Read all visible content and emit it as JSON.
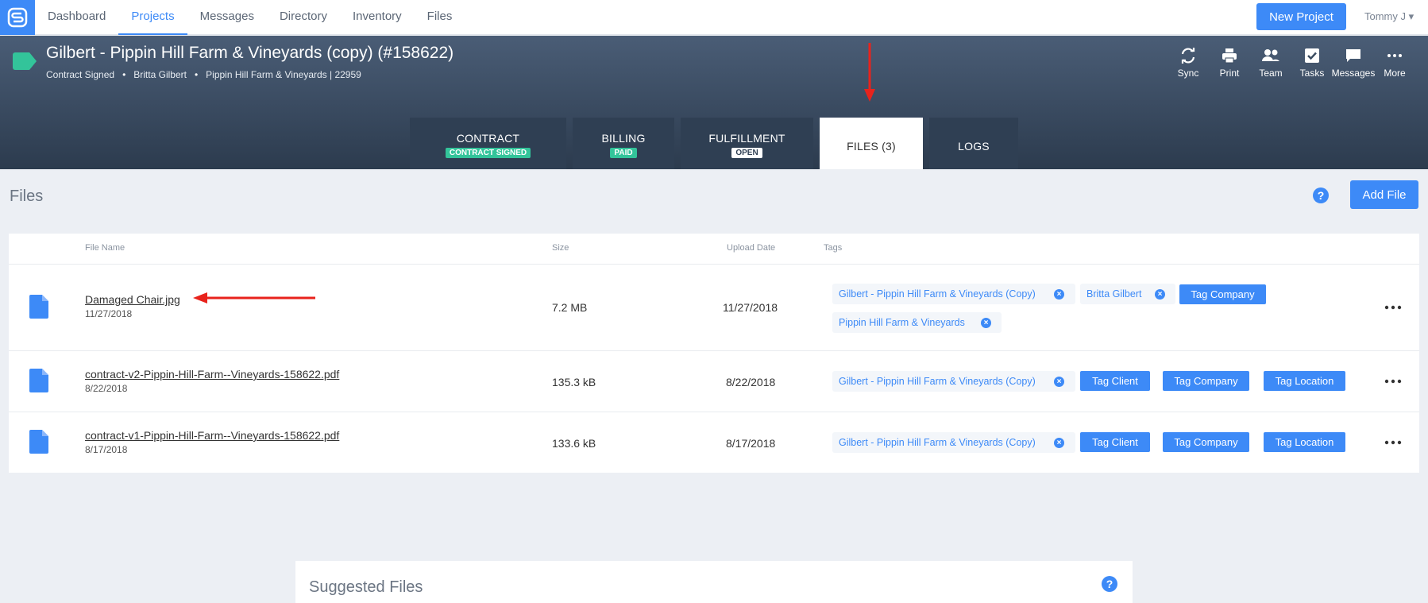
{
  "topnav": {
    "logo_icon": "logo-icon",
    "items": [
      {
        "label": "Dashboard",
        "active": false
      },
      {
        "label": "Projects",
        "active": true
      },
      {
        "label": "Messages",
        "active": false
      },
      {
        "label": "Directory",
        "active": false
      },
      {
        "label": "Inventory",
        "active": false
      },
      {
        "label": "Files",
        "active": false
      }
    ],
    "new_project_label": "New Project",
    "user_label": "Tommy J"
  },
  "project": {
    "title": "Gilbert - Pippin Hill Farm & Vineyards (copy) (#158622)",
    "meta": [
      "Contract Signed",
      "Britta Gilbert",
      "Pippin Hill Farm & Vineyards | 22959"
    ],
    "actions": [
      {
        "label": "Sync",
        "icon": "sync-icon"
      },
      {
        "label": "Print",
        "icon": "print-icon"
      },
      {
        "label": "Team",
        "icon": "team-icon"
      },
      {
        "label": "Tasks",
        "icon": "tasks-icon"
      },
      {
        "label": "Messages",
        "icon": "messages-icon"
      },
      {
        "label": "More",
        "icon": "more-icon"
      }
    ],
    "tabs": [
      {
        "label": "CONTRACT",
        "badge": "CONTRACT SIGNED"
      },
      {
        "label": "BILLING",
        "badge": "PAID"
      },
      {
        "label": "FULFILLMENT",
        "badge": "OPEN"
      },
      {
        "label": "FILES (3)",
        "badge": ""
      },
      {
        "label": "LOGS",
        "badge": ""
      }
    ]
  },
  "files": {
    "title": "Files",
    "add_label": "Add File",
    "headers": {
      "name": "File Name",
      "size": "Size",
      "date": "Upload Date",
      "tags": "Tags"
    },
    "rows": [
      {
        "name": "Damaged Chair.jpg",
        "sub_date": "11/27/2018",
        "size": "7.2 MB",
        "upload_date": "11/27/2018",
        "tags": [
          "Gilbert - Pippin Hill Farm & Vineyards (Copy)",
          "Britta Gilbert",
          "Pippin Hill Farm & Vineyards"
        ],
        "buttons": [
          "Tag Company"
        ]
      },
      {
        "name": "contract-v2-Pippin-Hill-Farm--Vineyards-158622.pdf",
        "sub_date": "8/22/2018",
        "size": "135.3 kB",
        "upload_date": "8/22/2018",
        "tags": [
          "Gilbert - Pippin Hill Farm & Vineyards (Copy)"
        ],
        "buttons": [
          "Tag Client",
          "Tag Company",
          "Tag Location"
        ]
      },
      {
        "name": "contract-v1-Pippin-Hill-Farm--Vineyards-158622.pdf",
        "sub_date": "8/17/2018",
        "size": "133.6 kB",
        "upload_date": "8/17/2018",
        "tags": [
          "Gilbert - Pippin Hill Farm & Vineyards (Copy)"
        ],
        "buttons": [
          "Tag Client",
          "Tag Company",
          "Tag Location"
        ]
      }
    ]
  },
  "suggested": {
    "title": "Suggested Files"
  },
  "colors": {
    "accent": "#3d8af7",
    "header_dark": "#2c3b4e",
    "badge_green": "#33c49a",
    "annotation": "#e8231c"
  }
}
